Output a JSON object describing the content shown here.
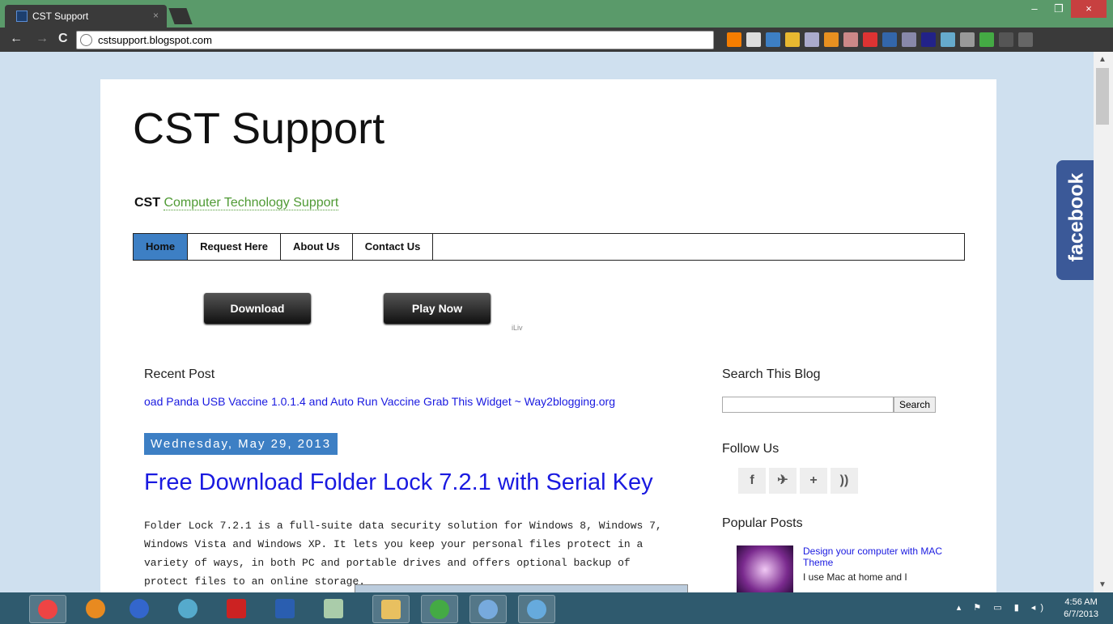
{
  "browser": {
    "tab_title": "CST Support",
    "tab_close": "×",
    "url": "cstsupport.blogspot.com",
    "window_buttons": [
      "–",
      "❐",
      "×"
    ]
  },
  "blog": {
    "title": "CST Support",
    "desc_prefix": "CST ",
    "desc_link": "Computer Technology Support"
  },
  "menu": [
    "Home",
    "Request Here",
    "About Us",
    "Contact Us"
  ],
  "ad": {
    "download_label": "Download",
    "play_label": "Play Now",
    "iliv": "iLiv"
  },
  "recent": {
    "title": "Recent Post",
    "ticker": "oad Panda USB Vaccine 1.0.1.4 and Auto Run Vaccine    Grab This Widget ~ Way2blogging.org"
  },
  "post": {
    "date": "Wednesday, May 29, 2013",
    "title": "Free Download Folder Lock 7.2.1 with Serial Key",
    "body": "Folder Lock 7.2.1 is a full-suite data security solution for Windows 8, Windows 7, Windows Vista and Windows XP. It lets you keep your personal files protect in a variety of ways, in both PC and portable drives and offers optional backup of protect files to an online storage."
  },
  "sidebar": {
    "search_title": "Search This Blog",
    "search_button": "Search",
    "follow_title": "Follow Us",
    "social_icons": [
      "f",
      "✈",
      "+",
      "))"
    ],
    "popular_title": "Popular Posts",
    "popular_link": "Design your computer with MAC Theme",
    "popular_snippet": "I use Mac at home and I"
  },
  "facebook_tab": "facebook",
  "taskbar": {
    "time": "4:56 AM",
    "date": "6/7/2013"
  },
  "colors": {
    "accent": "#3d7fc4",
    "link": "#1a1ae0",
    "desc_link": "#4f9a34",
    "facebook": "#3b5998"
  }
}
